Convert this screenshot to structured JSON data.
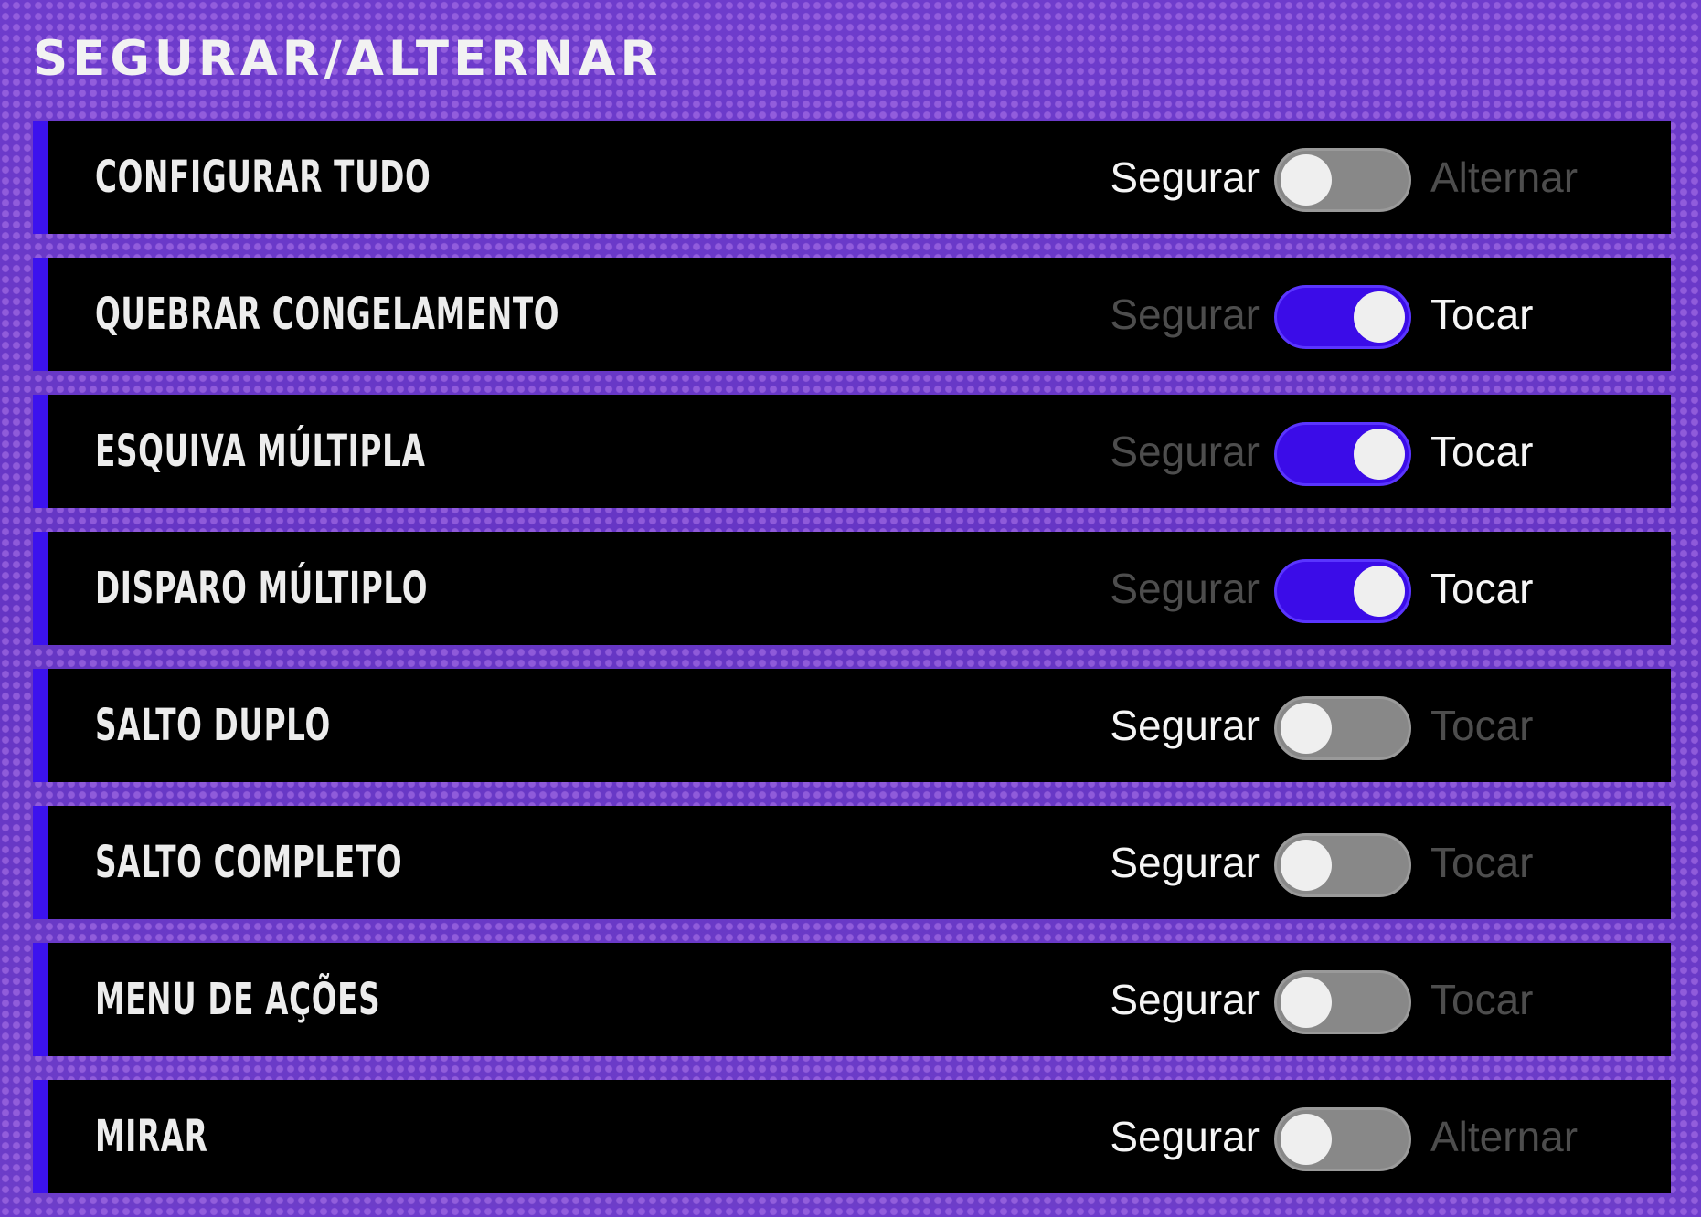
{
  "section": {
    "title": "SEGURAR/ALTERNAR"
  },
  "colors": {
    "accent": "#3c12ee",
    "toggle_on": "#3b0ce8",
    "toggle_off": "#888888",
    "row_background": "#000000",
    "page_background": "#6a36c8"
  },
  "settings": [
    {
      "label": "CONFIGURAR TUDO",
      "left_option": "Segurar",
      "right_option": "Alternar",
      "selected": "Segurar",
      "toggle_on": false
    },
    {
      "label": "QUEBRAR CONGELAMENTO",
      "left_option": "Segurar",
      "right_option": "Tocar",
      "selected": "Tocar",
      "toggle_on": true
    },
    {
      "label": "ESQUIVA MÚLTIPLA",
      "left_option": "Segurar",
      "right_option": "Tocar",
      "selected": "Tocar",
      "toggle_on": true
    },
    {
      "label": "DISPARO MÚLTIPLO",
      "left_option": "Segurar",
      "right_option": "Tocar",
      "selected": "Tocar",
      "toggle_on": true
    },
    {
      "label": "SALTO DUPLO",
      "left_option": "Segurar",
      "right_option": "Tocar",
      "selected": "Segurar",
      "toggle_on": false
    },
    {
      "label": "SALTO COMPLETO",
      "left_option": "Segurar",
      "right_option": "Tocar",
      "selected": "Segurar",
      "toggle_on": false
    },
    {
      "label": "MENU DE AÇÕES",
      "left_option": "Segurar",
      "right_option": "Tocar",
      "selected": "Segurar",
      "toggle_on": false
    },
    {
      "label": "MIRAR",
      "left_option": "Segurar",
      "right_option": "Alternar",
      "selected": "Segurar",
      "toggle_on": false
    }
  ]
}
